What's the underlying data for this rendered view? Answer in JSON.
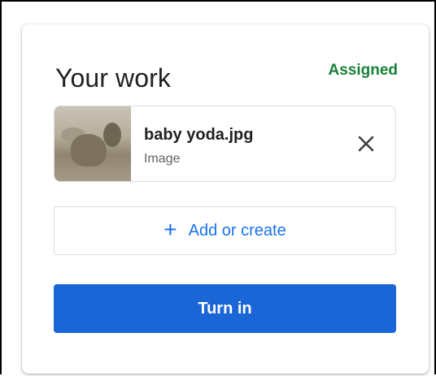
{
  "panel": {
    "title": "Your work",
    "status": "Assigned"
  },
  "attachment": {
    "name": "baby yoda.jpg",
    "type": "Image",
    "thumbnail_icon": "image-thumbnail",
    "remove_icon": "close-icon"
  },
  "actions": {
    "add_plus": "+",
    "add_label": "Add or create",
    "turn_in_label": "Turn in"
  },
  "colors": {
    "status": "#188038",
    "accent": "#1a73e8",
    "primary_button": "#1a66d6",
    "text": "#202124",
    "muted": "#5f6368",
    "border": "#dadce0"
  }
}
